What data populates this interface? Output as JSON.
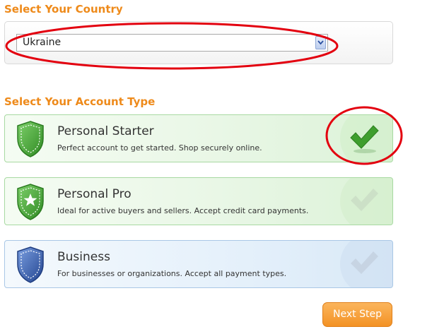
{
  "country_section": {
    "title": "Select Your Country",
    "selected_country": "Ukraine"
  },
  "account_section": {
    "title": "Select Your Account Type",
    "options": [
      {
        "title": "Personal Starter",
        "description": "Perfect account to get started. Shop securely online.",
        "selected": true,
        "color": "#4caf3f"
      },
      {
        "title": "Personal Pro",
        "description": "Ideal for active buyers and sellers. Accept credit card payments.",
        "selected": false,
        "color": "#4caf3f"
      },
      {
        "title": "Business",
        "description": "For businesses or organizations. Accept all payment types.",
        "selected": false,
        "color": "#3a62b0"
      }
    ]
  },
  "next_button": {
    "label": "Next Step"
  },
  "colors": {
    "accent": "#ee8a1a",
    "highlight": "#e3000f",
    "check_green": "#3f9e2e"
  },
  "icons": [
    "chevron-down-icon",
    "shield-icon",
    "shield-star-icon",
    "checkmark-icon"
  ]
}
